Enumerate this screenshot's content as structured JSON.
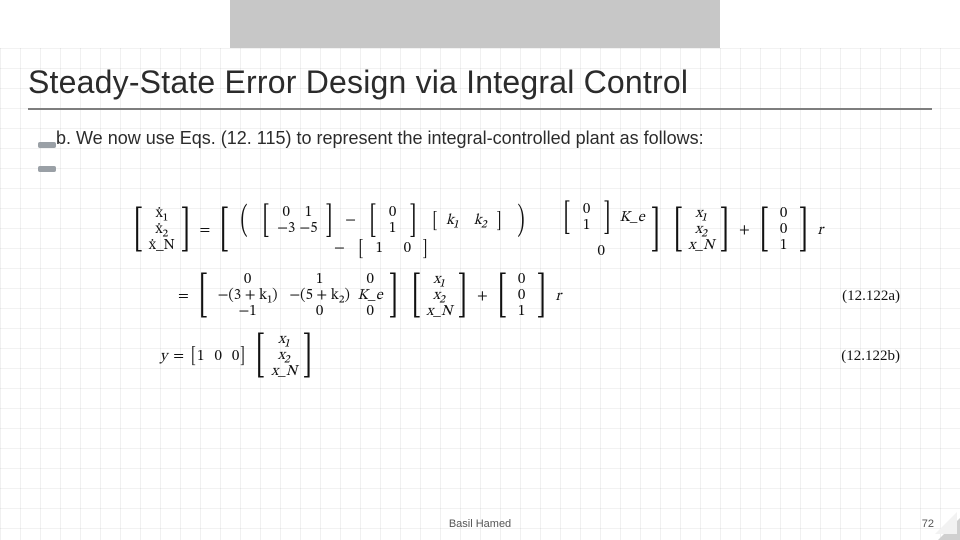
{
  "title": "Steady-State Error Design via Integral Control",
  "paragraph_b": "b. We now use Eqs. (12. 115) to represent the integral-controlled plant as follows:",
  "eq": {
    "xdot": [
      "ẋ₁",
      "ẋ₂",
      "ẋ_N"
    ],
    "A0": [
      [
        "0",
        "1"
      ],
      [
        "−3",
        "−5"
      ]
    ],
    "B0": [
      "0",
      "1"
    ],
    "Krow": [
      "k₁",
      "k₂"
    ],
    "Ke_col": [
      "0",
      "1"
    ],
    "Ke_label": "K_e",
    "obs_row": [
      "1",
      "0"
    ],
    "zero_scalar": "0",
    "x": [
      "x₁",
      "x₂",
      "x_N"
    ],
    "Br": [
      "0",
      "0",
      "1"
    ],
    "r": "r",
    "eq_sign": "=",
    "plus_sign": "+",
    "minus_sign": "−",
    "A_exp": [
      [
        "0",
        "1",
        "0"
      ],
      [
        "−(3 + k₁)",
        "−(5 + k₂)",
        "K_e"
      ],
      [
        "−1",
        "0",
        "0"
      ]
    ],
    "y_label": "y",
    "Crow": [
      "1",
      "0",
      "0"
    ],
    "num_a": "(12.122a)",
    "num_b": "(12.122b)"
  },
  "footer": {
    "author": "Basil Hamed",
    "page": "72"
  }
}
